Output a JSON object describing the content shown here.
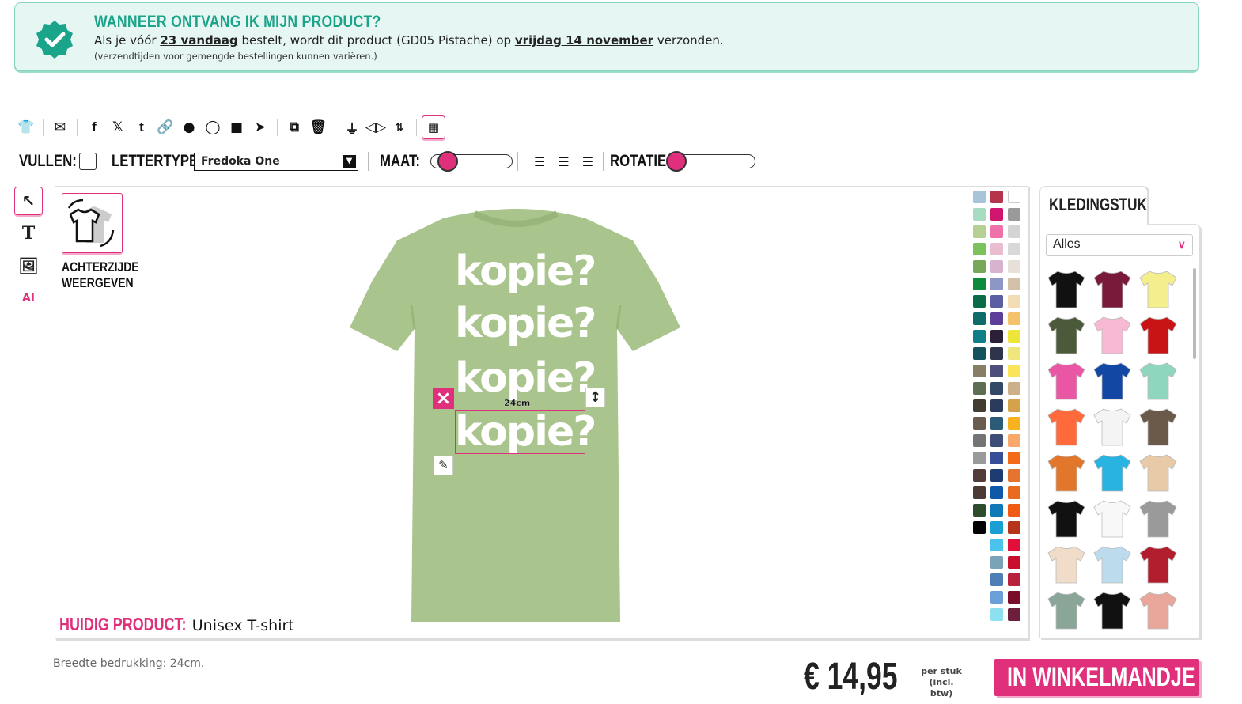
{
  "banner": {
    "title": "WANNEER ONTVANG IK MIJN PRODUCT?",
    "line_pre": "Als je vóór ",
    "time": "23 vandaag",
    "line_mid": " bestelt, wordt dit product (GD05 Pistache) op ",
    "date": "vrijdag 14 november",
    "line_post": " verzonden.",
    "note": "(verzendtijden voor gemengde bestellingen kunnen variëren.)"
  },
  "toolbar": {
    "icons": [
      "tshirt-icon",
      "mail-icon",
      "facebook-icon",
      "x-icon",
      "tumblr-icon",
      "link-icon",
      "reddit-icon",
      "whatsapp-icon",
      "teams-icon",
      "telegram-icon",
      "copy-icon",
      "trash-icon",
      "align-center-icon",
      "flip-horizontal-icon",
      "flip-vertical-icon",
      "grid-snap-icon"
    ]
  },
  "options": {
    "fill_label": "VULLEN:",
    "font_label": "LETTERTYPE:",
    "font_value": "Fredoka One",
    "size_label": "MAAT:",
    "rotation_label": "ROTATIE:"
  },
  "canvas": {
    "back_label_1": "ACHTERZIJDE",
    "back_label_2": "WEERGEVEN",
    "texts": [
      "kopie?",
      "kopie?",
      "kopie?",
      "kopie?"
    ],
    "dimension": "24cm",
    "current_label": "HUIDIG PRODUCT:",
    "current_value": " Unisex T-shirt",
    "shirt_color": "#a9c48c",
    "accent": "#e0307c"
  },
  "panel": {
    "tab": "KLEDINGSTUK",
    "filter": "Alles"
  },
  "footer": {
    "note": "Breedte bedrukking: 24cm.",
    "price": "€ 14,95",
    "per_stuk": "per stuk",
    "incl": "(incl. btw)",
    "cart": "IN WINKELMANDJE"
  }
}
